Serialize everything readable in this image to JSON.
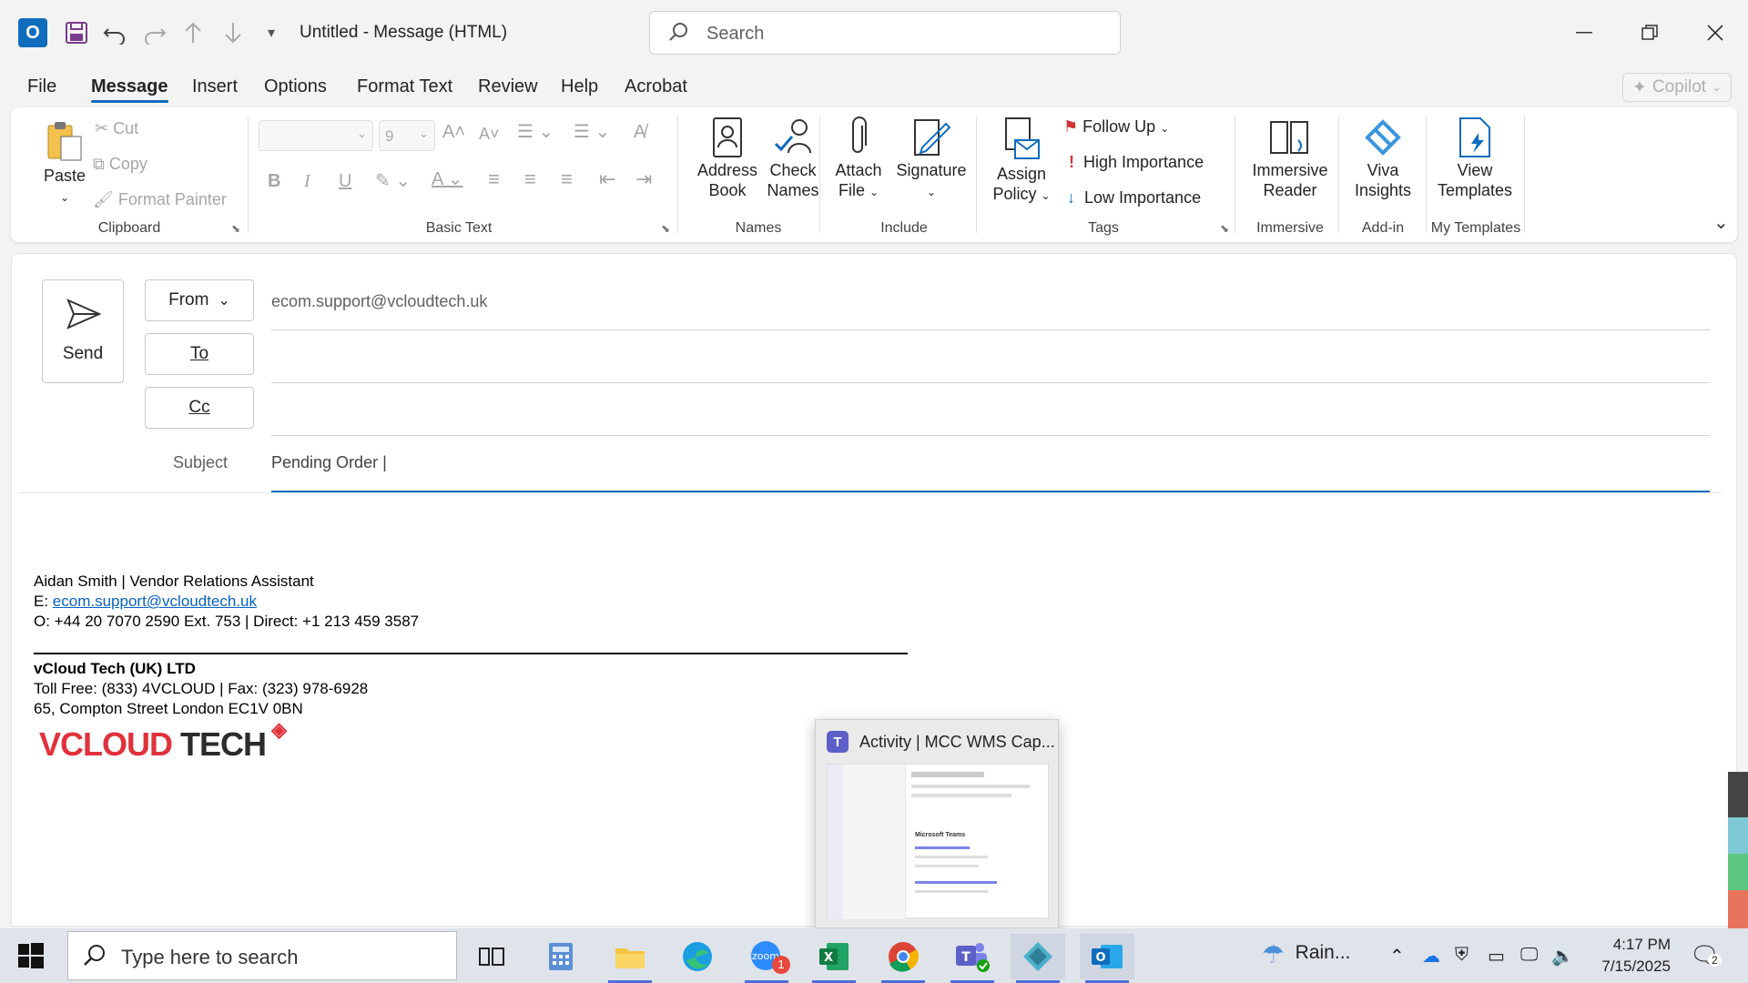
{
  "titlebar": {
    "title": "Untitled  -  Message (HTML)",
    "search_placeholder": "Search",
    "app_letter": "O"
  },
  "menu": {
    "tabs": [
      {
        "label": "File"
      },
      {
        "label": "Message",
        "active": true
      },
      {
        "label": "Insert"
      },
      {
        "label": "Options"
      },
      {
        "label": "Format Text"
      },
      {
        "label": "Review"
      },
      {
        "label": "Help"
      },
      {
        "label": "Acrobat"
      }
    ],
    "copilot": "Copilot"
  },
  "ribbon": {
    "clipboard": {
      "paste": "Paste",
      "cut": "Cut",
      "copy": "Copy",
      "format_painter": "Format Painter",
      "label": "Clipboard"
    },
    "basic_text": {
      "font_size": "9",
      "label": "Basic Text"
    },
    "names": {
      "address_book_1": "Address",
      "address_book_2": "Book",
      "check_names_1": "Check",
      "check_names_2": "Names",
      "label": "Names"
    },
    "include": {
      "attach_1": "Attach",
      "attach_2": "File",
      "signature": "Signature",
      "label": "Include"
    },
    "tags": {
      "assign_1": "Assign",
      "assign_2": "Policy",
      "follow_up": "Follow Up",
      "high": "High Importance",
      "low": "Low Importance",
      "label": "Tags"
    },
    "immersive": {
      "reader_1": "Immersive",
      "reader_2": "Reader",
      "label": "Immersive"
    },
    "addin": {
      "viva_1": "Viva",
      "viva_2": "Insights",
      "label": "Add-in"
    },
    "templates": {
      "view_1": "View",
      "view_2": "Templates",
      "label": "My Templates"
    }
  },
  "compose": {
    "send": "Send",
    "from_label": "From",
    "from_value": "ecom.support@vcloudtech.uk",
    "to_label": "To",
    "cc_label": "Cc",
    "subject_label": "Subject",
    "subject_value": "Pending Order |"
  },
  "signature": {
    "name_line": "Aidan Smith | Vendor Relations Assistant",
    "email_prefix": "E: ",
    "email": "ecom.support@vcloudtech.uk",
    "office_line": "O:  +44 20 7070 2590 Ext. 753 | Direct: +1 213 459 3587",
    "company": "vCloud Tech (UK) LTD",
    "tollfree_line": "Toll Free: (833) 4VCLOUD | Fax: (323) 978-6928",
    "address_line": "65, Compton Street London EC1V 0BN",
    "logo_text_1": "VCLOUD",
    "logo_text_2": "TECH"
  },
  "thumbnail": {
    "title": "Activity | MCC WMS Cap...",
    "preview_heading": "Microsoft Teams"
  },
  "taskbar": {
    "search_placeholder": "Type here to search",
    "weather": "Rain...",
    "time": "4:17 PM",
    "date": "7/15/2025",
    "zoom_badge": "1",
    "notif_count": "2"
  },
  "colors": {
    "accent": "#0f6cbd",
    "logo_red": "#e0323a",
    "high_importance": "#d13438",
    "link": "#0563c1"
  }
}
